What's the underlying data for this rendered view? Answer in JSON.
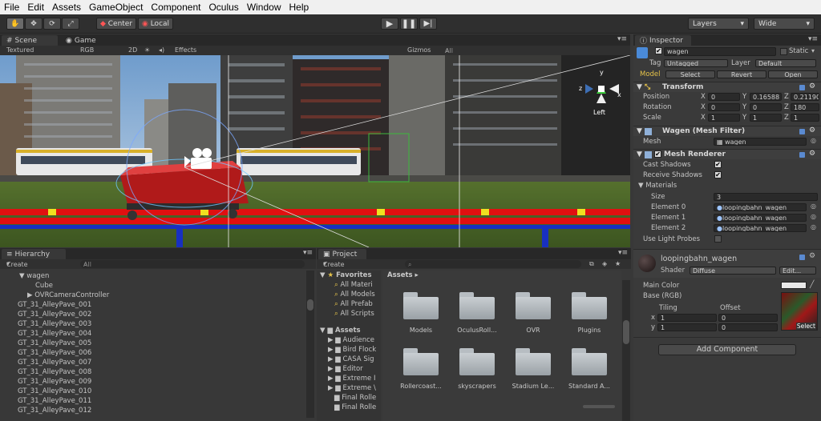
{
  "menu": [
    "File",
    "Edit",
    "Assets",
    "GameObject",
    "Component",
    "Oculus",
    "Window",
    "Help"
  ],
  "toolbar": {
    "pivot": "Center",
    "space": "Local",
    "layers": "Layers",
    "layout": "Wide"
  },
  "scene": {
    "tab_scene": "Scene",
    "tab_game": "Game",
    "render_mode": "Textured",
    "color_mode": "RGB",
    "mode_2d": "2D",
    "effects": "Effects",
    "gizmos": "Gizmos",
    "search": "All",
    "gizmo_label": "Left",
    "axis_x": "x",
    "axis_y": "y",
    "axis_z": "z"
  },
  "hierarchy": {
    "title": "Hierarchy",
    "create": "Create",
    "search": "All",
    "items": [
      "wagen",
      "Cube",
      "OVRCameraController",
      "GT_31_AlleyPave_001",
      "GT_31_AlleyPave_002",
      "GT_31_AlleyPave_003",
      "GT_31_AlleyPave_004",
      "GT_31_AlleyPave_005",
      "GT_31_AlleyPave_006",
      "GT_31_AlleyPave_007",
      "GT_31_AlleyPave_008",
      "GT_31_AlleyPave_009",
      "GT_31_AlleyPave_010",
      "GT_31_AlleyPave_011",
      "GT_31_AlleyPave_012"
    ]
  },
  "project": {
    "title": "Project",
    "create": "Create",
    "favorites": "Favorites",
    "fav_items": [
      "All Materi",
      "All Models",
      "All Prefab",
      "All Scripts"
    ],
    "assets": "Assets",
    "asset_tree": [
      "Audience",
      "Bird Flock",
      "CASA Sig",
      "Editor",
      "Extreme I",
      "Extreme \\",
      "Final Rolle",
      "Final Rolle"
    ],
    "breadcrumb": "Assets",
    "folders": [
      "Models",
      "OculusRoll...",
      "OVR",
      "Plugins",
      "Rollercoast...",
      "skyscrapers",
      "Stadium Le...",
      "Standard A..."
    ]
  },
  "inspector": {
    "title": "Inspector",
    "name": "wagen",
    "static": "Static",
    "tag_label": "Tag",
    "tag": "Untagged",
    "layer_label": "Layer",
    "layer": "Default",
    "model_label": "Model",
    "select": "Select",
    "revert": "Revert",
    "open": "Open",
    "transform": {
      "title": "Transform",
      "position": "Position",
      "rotation": "Rotation",
      "scale": "Scale",
      "pos": [
        "0",
        "0.16588",
        "0.21190"
      ],
      "rot": [
        "0",
        "0",
        "180"
      ],
      "scl": [
        "1",
        "1",
        "1"
      ]
    },
    "mesh_filter": {
      "title": "Wagen  (Mesh Filter)",
      "mesh_label": "Mesh",
      "mesh": "wagen"
    },
    "mesh_renderer": {
      "title": "Mesh Renderer",
      "cast": "Cast Shadows",
      "receive": "Receive Shadows",
      "materials": "Materials",
      "size_label": "Size",
      "size": "3",
      "elements": [
        {
          "label": "Element 0",
          "value": "loopingbahn_wagen"
        },
        {
          "label": "Element 1",
          "value": "loopingbahn_wagen"
        },
        {
          "label": "Element 2",
          "value": "loopingbahn_wagen"
        }
      ],
      "light_probes": "Use Light Probes"
    },
    "material": {
      "name": "loopingbahn_wagen",
      "shader_label": "Shader",
      "shader": "Diffuse",
      "edit": "Edit...",
      "main_color": "Main Color",
      "base": "Base (RGB)",
      "tiling": "Tiling",
      "offset": "Offset",
      "x_label": "x",
      "y_label": "y",
      "tile_x": "1",
      "tile_y": "1",
      "off_x": "0",
      "off_y": "0",
      "select": "Select"
    },
    "add_component": "Add Component"
  },
  "colors": {
    "accent": "#3d6eb4",
    "selected": "#3e5f96",
    "sky": "#8fb3d6",
    "grass": "#4a6b2a",
    "rail_red": "#e01010",
    "rail_blue": "#1830c0"
  }
}
